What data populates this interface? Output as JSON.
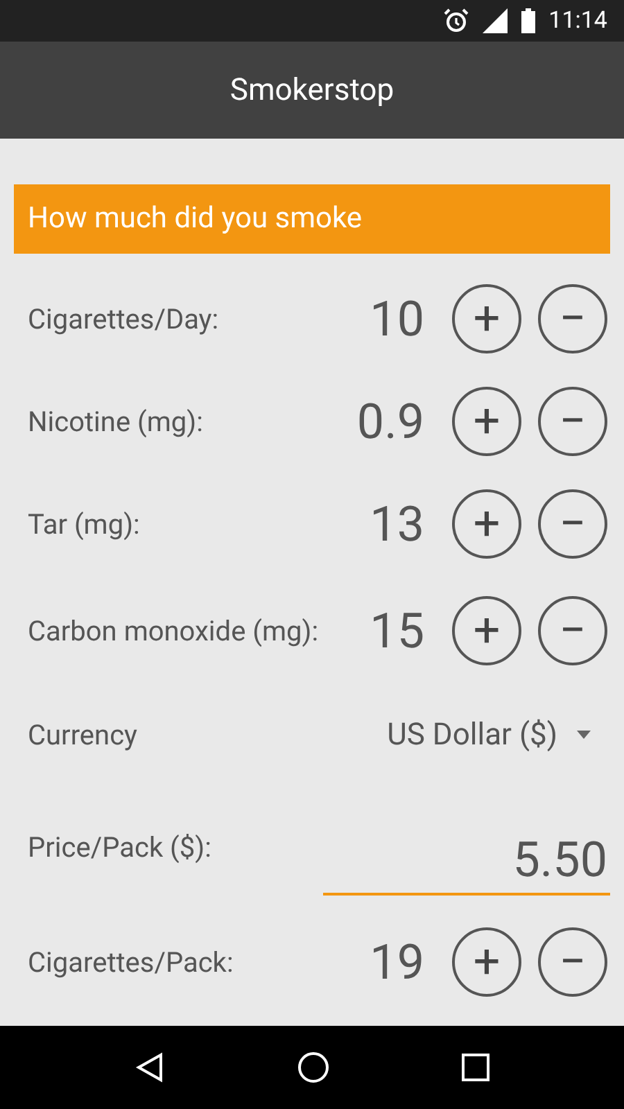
{
  "status_bar": {
    "time": "11:14"
  },
  "app_bar": {
    "title": "Smokerstop"
  },
  "section": {
    "title": "How much did you smoke"
  },
  "rows": [
    {
      "kind": "stepper",
      "label": "Cigarettes/Day:",
      "value": "10",
      "plus": "+",
      "minus": "−"
    },
    {
      "kind": "stepper",
      "label": "Nicotine (mg):",
      "value": "0.9",
      "plus": "+",
      "minus": "−"
    },
    {
      "kind": "stepper",
      "label": "Tar (mg):",
      "value": "13",
      "plus": "+",
      "minus": "−"
    },
    {
      "kind": "stepper",
      "label": "Carbon monoxide (mg):",
      "value": "15",
      "plus": "+",
      "minus": "−"
    },
    {
      "kind": "dropdown",
      "label": "Currency",
      "value": "US Dollar ($)"
    },
    {
      "kind": "input",
      "label": "Price/Pack ($):",
      "value": "5.50",
      "focused": true
    },
    {
      "kind": "stepper",
      "label": "Cigarettes/Pack:",
      "value": "19",
      "plus": "+",
      "minus": "−"
    }
  ]
}
